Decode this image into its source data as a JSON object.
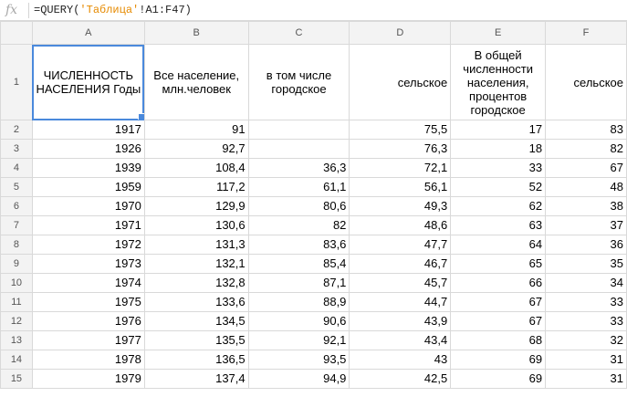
{
  "formula_bar": {
    "fx_label": "fx",
    "formula_prefix": "=QUERY(",
    "formula_ref": "'Таблица'",
    "formula_suffix": "!A1:F47)"
  },
  "columns": [
    "A",
    "B",
    "C",
    "D",
    "E",
    "F"
  ],
  "header_row": {
    "row_number": "1",
    "cells": [
      "ЧИСЛЕННОСТЬ НАСЕЛЕНИЯ Годы",
      "Все население, млн.человек",
      "в том числе городское",
      "сельское",
      "В общей численности населения, процентов городское",
      "сельское"
    ]
  },
  "rows": [
    {
      "n": "2",
      "cells": [
        "1917",
        "91",
        "",
        "75,5",
        "17",
        "83"
      ]
    },
    {
      "n": "3",
      "cells": [
        "1926",
        "92,7",
        "",
        "76,3",
        "18",
        "82"
      ]
    },
    {
      "n": "4",
      "cells": [
        "1939",
        "108,4",
        "36,3",
        "72,1",
        "33",
        "67"
      ]
    },
    {
      "n": "5",
      "cells": [
        "1959",
        "117,2",
        "61,1",
        "56,1",
        "52",
        "48"
      ]
    },
    {
      "n": "6",
      "cells": [
        "1970",
        "129,9",
        "80,6",
        "49,3",
        "62",
        "38"
      ]
    },
    {
      "n": "7",
      "cells": [
        "1971",
        "130,6",
        "82",
        "48,6",
        "63",
        "37"
      ]
    },
    {
      "n": "8",
      "cells": [
        "1972",
        "131,3",
        "83,6",
        "47,7",
        "64",
        "36"
      ]
    },
    {
      "n": "9",
      "cells": [
        "1973",
        "132,1",
        "85,4",
        "46,7",
        "65",
        "35"
      ]
    },
    {
      "n": "10",
      "cells": [
        "1974",
        "132,8",
        "87,1",
        "45,7",
        "66",
        "34"
      ]
    },
    {
      "n": "11",
      "cells": [
        "1975",
        "133,6",
        "88,9",
        "44,7",
        "67",
        "33"
      ]
    },
    {
      "n": "12",
      "cells": [
        "1976",
        "134,5",
        "90,6",
        "43,9",
        "67",
        "33"
      ]
    },
    {
      "n": "13",
      "cells": [
        "1977",
        "135,5",
        "92,1",
        "43,4",
        "68",
        "32"
      ]
    },
    {
      "n": "14",
      "cells": [
        "1978",
        "136,5",
        "93,5",
        "43",
        "69",
        "31"
      ]
    },
    {
      "n": "15",
      "cells": [
        "1979",
        "137,4",
        "94,9",
        "42,5",
        "69",
        "31"
      ]
    }
  ],
  "colors": {
    "selection": "#4a89dc",
    "formula_ref": "#e68a00",
    "header_bg": "#f3f3f3",
    "grid_line": "#d9d9d9"
  }
}
